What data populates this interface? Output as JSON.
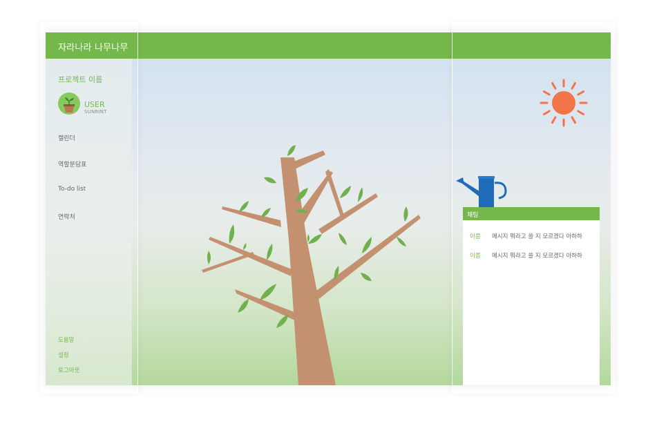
{
  "app": {
    "title": "자라나라 나무나무"
  },
  "sidebar": {
    "project_name": "프로젝트 이름",
    "user": {
      "name": "USER",
      "subtitle": "SUNRINT"
    },
    "menu": [
      {
        "label": "캘린더"
      },
      {
        "label": "역할분담표"
      },
      {
        "label": "To-do list"
      },
      {
        "label": "연락처"
      }
    ],
    "bottom": [
      {
        "label": "도움말"
      },
      {
        "label": "설정"
      },
      {
        "label": "로그아웃"
      }
    ]
  },
  "chat": {
    "title": "채팅",
    "messages": [
      {
        "name": "이름",
        "text": "메시지 뭐라고 쓸 지 모르겠다 아하하"
      },
      {
        "name": "이름",
        "text": "메시지 뭐라고 쓸 지 모르겠다 아하하"
      }
    ]
  },
  "colors": {
    "brand_green": "#74b84b",
    "sun": "#f4744a",
    "watering_can": "#1f6bb8",
    "tree_trunk": "#c49170",
    "leaf": "#72b04e"
  }
}
